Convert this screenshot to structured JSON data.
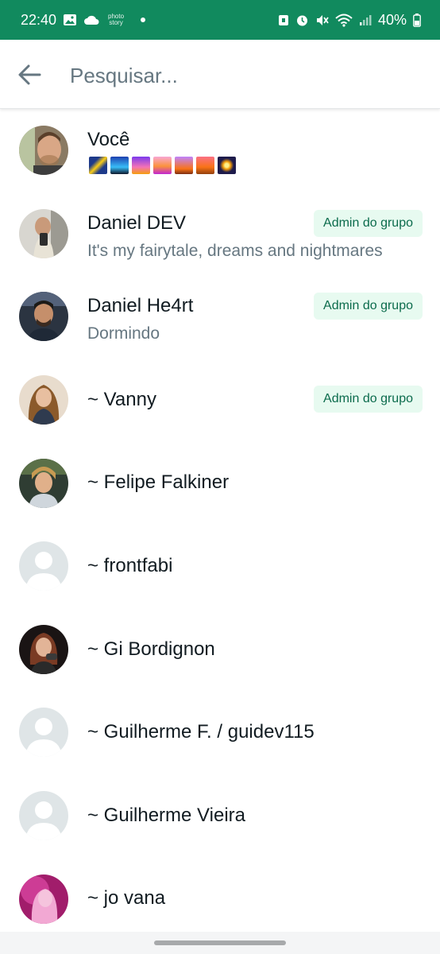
{
  "status_bar": {
    "time": "22:40",
    "battery": "40%",
    "tiny_label": "photo story"
  },
  "search": {
    "placeholder": "Pesquisar..."
  },
  "members": [
    {
      "name": "Você",
      "subtitle": "",
      "badge": "",
      "avatar": "photo"
    },
    {
      "name": "Daniel DEV",
      "subtitle": "It's my fairytale, dreams and nightmares",
      "badge": "Admin do grupo",
      "avatar": "photo"
    },
    {
      "name": "Daniel He4rt",
      "subtitle": "Dormindo",
      "badge": "Admin do grupo",
      "avatar": "photo"
    },
    {
      "name": "~ Vanny",
      "subtitle": "",
      "badge": "Admin do grupo",
      "avatar": "photo"
    },
    {
      "name": "~ Felipe Falkiner",
      "subtitle": "",
      "badge": "",
      "avatar": "photo"
    },
    {
      "name": "~ frontfabi",
      "subtitle": "",
      "badge": "",
      "avatar": "default"
    },
    {
      "name": "~ Gi Bordignon",
      "subtitle": "",
      "badge": "",
      "avatar": "photo"
    },
    {
      "name": "~ Guilherme F. / guidev115",
      "subtitle": "",
      "badge": "",
      "avatar": "default"
    },
    {
      "name": "~ Guilherme Vieira",
      "subtitle": "",
      "badge": "",
      "avatar": "default"
    },
    {
      "name": "~ jo vana",
      "subtitle": "",
      "badge": "",
      "avatar": "photo"
    }
  ],
  "colors": {
    "header_green": "#118a5e",
    "badge_bg": "#e7faf0",
    "badge_text": "#0b6b4c"
  }
}
